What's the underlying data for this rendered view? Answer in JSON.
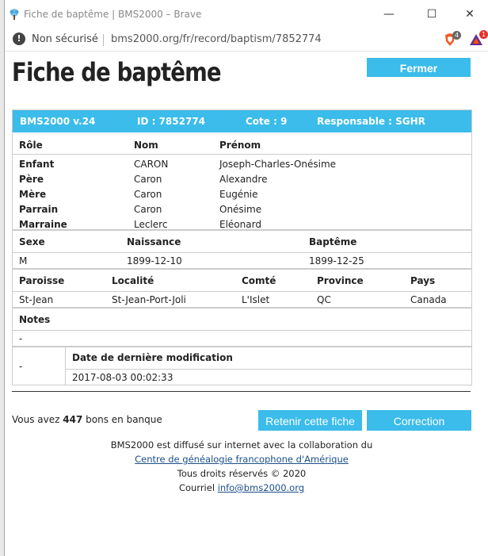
{
  "window": {
    "title": "Fiche de baptême | BMS2000 – Brave",
    "minimize": "—",
    "maximize": "☐",
    "close": "✕"
  },
  "address": {
    "security": "Non sécurisé",
    "url": "bms2000.org/fr/record/baptism/7852774",
    "brave_badge": "4",
    "rewards_badge": "1"
  },
  "page": {
    "title": "Fiche de baptême",
    "close_label": "Fermer"
  },
  "record": {
    "header": {
      "version": "BMS2000 v.24",
      "id": "ID : 7852774",
      "cote": "Cote : 9",
      "responsable": "Responsable : SGHR"
    },
    "persons": {
      "headers": [
        "Rôle",
        "Nom",
        "Prénom"
      ],
      "rows": [
        {
          "role": "Enfant",
          "nom": "CARON",
          "prenom": "Joseph-Charles-Onésime"
        },
        {
          "role": "Père",
          "nom": "Caron",
          "prenom": "Alexandre"
        },
        {
          "role": "Mère",
          "nom": "Caron",
          "prenom": "Eugénie"
        },
        {
          "role": "Parrain",
          "nom": "Caron",
          "prenom": "Onésime"
        },
        {
          "role": "Marraine",
          "nom": "Leclerc",
          "prenom": "Eléonard"
        }
      ]
    },
    "event": {
      "headers": [
        "Sexe",
        "Naissance",
        "Baptême"
      ],
      "values": [
        "M",
        "1899-12-10",
        "1899-12-25"
      ]
    },
    "place": {
      "headers": [
        "Paroisse",
        "Localité",
        "Comté",
        "Province",
        "Pays"
      ],
      "values": [
        "St-Jean",
        "St-Jean-Port-Joli",
        "L'Islet",
        "QC",
        "Canada"
      ]
    },
    "notes": {
      "header": "Notes",
      "value": "-"
    },
    "modification": {
      "left": "-",
      "header": "Date de dernière modification",
      "value": "2017-08-03 00:02:33"
    }
  },
  "bank": {
    "prefix": "Vous avez",
    "count": "447",
    "suffix": "bons en banque"
  },
  "actions": {
    "keep": "Retenir cette fiche",
    "correction": "Correction"
  },
  "footer": {
    "line1": "BMS2000 est diffusé sur internet avec la collaboration du",
    "link": "Centre de généalogie francophone d'Amérique",
    "rights": "Tous droits réservés © 2020",
    "mail_prefix": "Courriel",
    "mail": "info@bms2000.org"
  }
}
